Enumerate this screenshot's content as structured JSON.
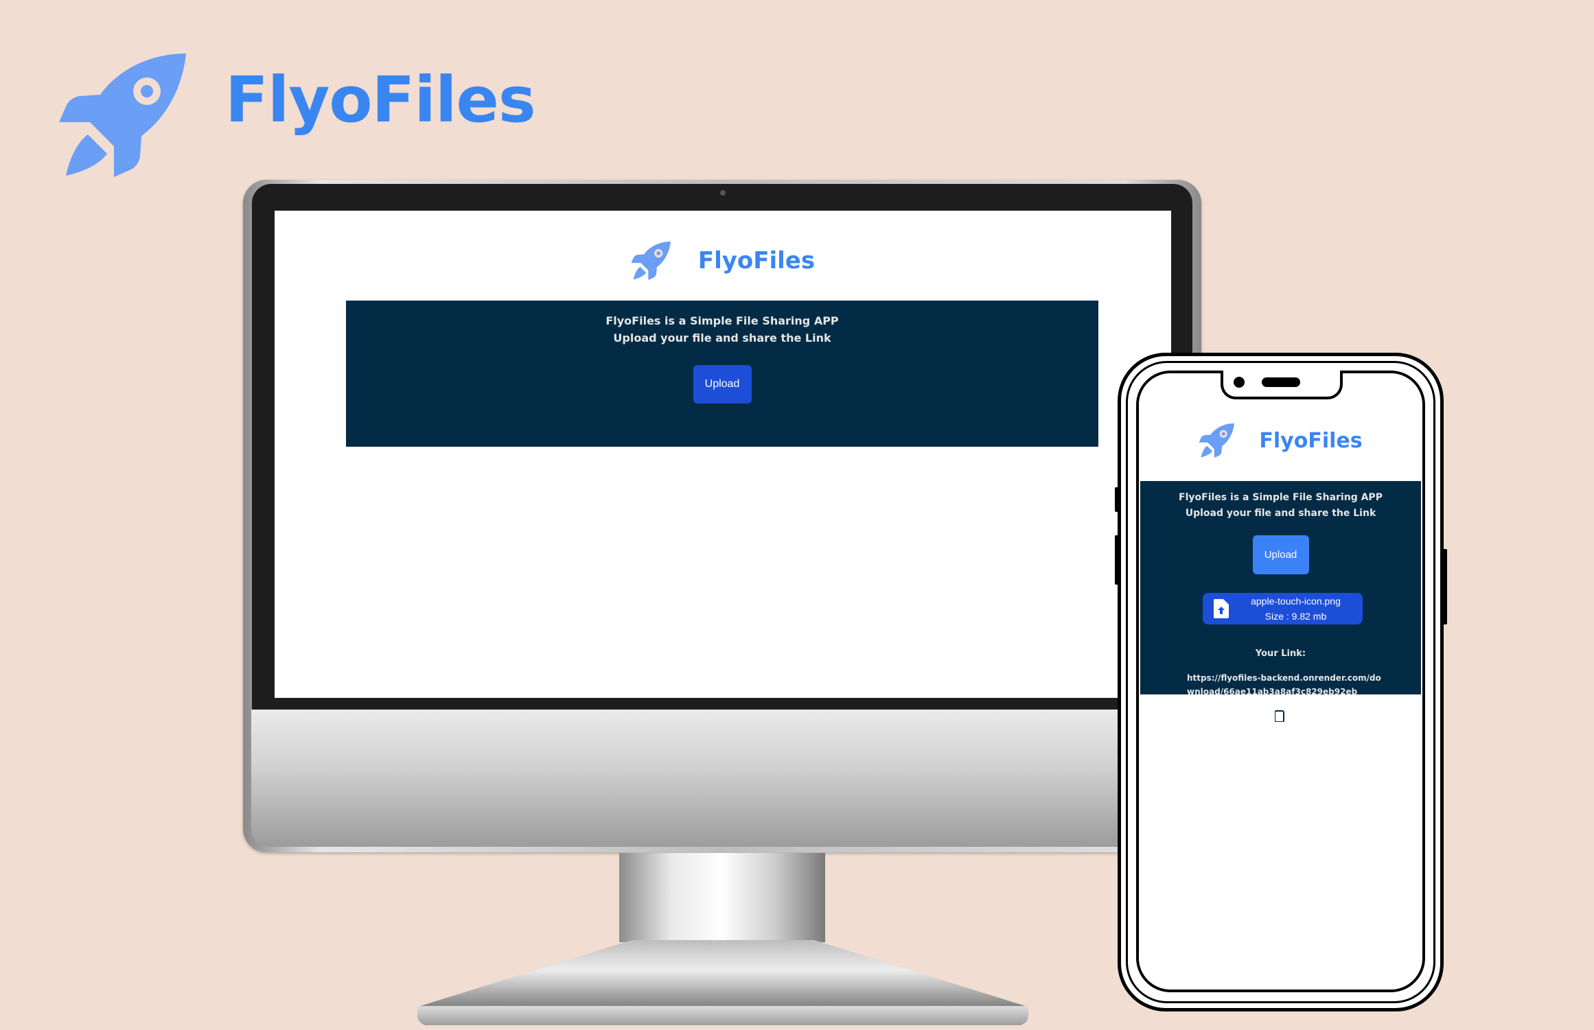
{
  "brand": {
    "name": "FlyoFiles",
    "icon": "rocket-icon",
    "color": "#3a86f0"
  },
  "desktop": {
    "header_title": "FlyoFiles",
    "panel": {
      "line1": "FlyoFiles is a Simple File Sharing APP",
      "line2": "Upload your file and share the Link",
      "upload_label": "Upload"
    }
  },
  "mobile": {
    "header_title": "FlyoFiles",
    "panel": {
      "line1": "FlyoFiles is a Simple File Sharing APP",
      "line2": "Upload your file and share the Link",
      "upload_label": "Upload"
    },
    "file": {
      "name": "apple-touch-icon.png",
      "size": "Size : 9.82 mb",
      "icon": "file-upload-icon"
    },
    "link_label": "Your Link:",
    "link_line1": "https://flyofiles-backend.onrender.com/do",
    "link_line2": "wnload/66ae11ab3a8af3c829eb92eb",
    "copy_icon": "copy-icon"
  },
  "colors": {
    "background": "#f1ddd1",
    "panel": "#032b45",
    "button_desktop": "#1d4ed8",
    "button_mobile": "#3b82f6",
    "file_chip": "#1d4ed8"
  }
}
